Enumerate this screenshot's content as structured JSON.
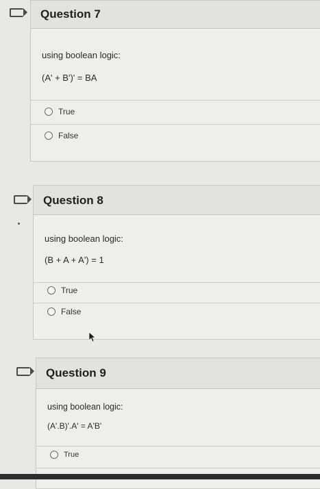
{
  "questions": [
    {
      "title": "Question 7",
      "prompt": "using boolean logic:",
      "expression": "(A' + B')' = BA",
      "options": [
        "True",
        "False"
      ]
    },
    {
      "title": "Question 8",
      "prompt": "using boolean logic:",
      "expression": "(B + A + A') = 1",
      "options": [
        "True",
        "False"
      ]
    },
    {
      "title": "Question 9",
      "prompt": "using boolean logic:",
      "expression": "(A'.B)'.A' = A'B'",
      "options": [
        "True"
      ]
    }
  ],
  "icons": {
    "question_marker": "bookmark-flag-icon",
    "pointer": "mouse-cursor-icon"
  },
  "colors": {
    "page_background": "#e9e8e4",
    "header_background": "#e3e2de",
    "border": "#c9c8c3"
  }
}
